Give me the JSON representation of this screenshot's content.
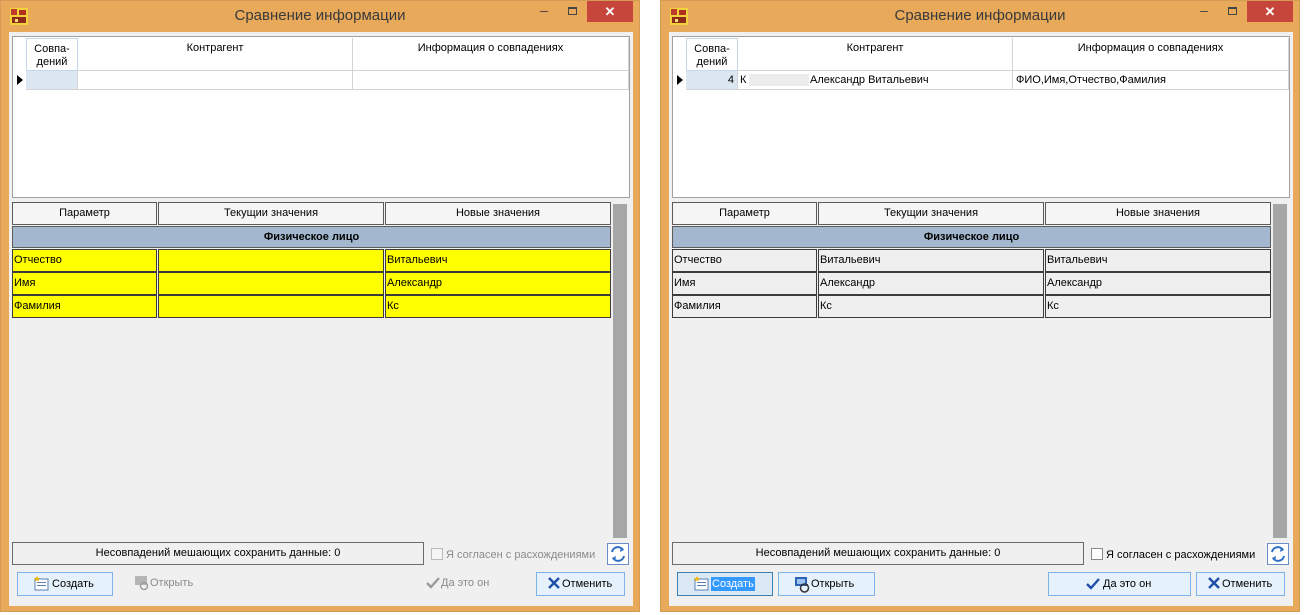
{
  "window_title": "Сравнение информации",
  "title_buttons": {
    "minimize": "–",
    "close": "✕"
  },
  "matches_grid": {
    "headers": [
      "Совпа-\nдений",
      "Контрагент",
      "Информация о совпадениях"
    ]
  },
  "compare_grid": {
    "headers": [
      "Параметр",
      "Текущии значения",
      "Новые значения"
    ],
    "group": "Физическое лицо"
  },
  "left": {
    "rows": [
      {
        "param": "Отчество",
        "current": "",
        "new": "Витальевич"
      },
      {
        "param": "Имя",
        "current": "",
        "new": "Александр"
      },
      {
        "param": "Фамилия",
        "current": "",
        "new": "Кс"
      }
    ],
    "status": "Несовпадений мешающих сохранить данные: 0",
    "agree_label": "Я согласен с расхождениями",
    "buttons": {
      "create": "Создать",
      "open": "Открыть",
      "yes": "Да это он",
      "cancel": "Отменить"
    }
  },
  "right": {
    "match": {
      "count": "4",
      "contractor_initial": "К",
      "contractor_name": "Александр Витальевич",
      "info": "ФИО,Имя,Отчество,Фамилия"
    },
    "rows": [
      {
        "param": "Отчество",
        "current": "Витальевич",
        "new": "Витальевич"
      },
      {
        "param": "Имя",
        "current": "Александр",
        "new": "Александр"
      },
      {
        "param": "Фамилия",
        "current": "Кс",
        "new": "Кс"
      }
    ],
    "status": "Несовпадений мешающих сохранить данные: 0",
    "agree_label": "Я согласен с расхождениями",
    "buttons": {
      "create": "Создать",
      "open": "Открыть",
      "yes": "Да это он",
      "cancel": "Отменить"
    }
  },
  "colors": {
    "window_frame": "#e8a95b",
    "close_button": "#c7463c",
    "mismatch_row": "#ffff00",
    "group_header": "#a3b8cf",
    "scrollbar": "#a6a6a6"
  },
  "icons": [
    "app-icon",
    "create-icon",
    "open-icon",
    "checkmark-icon",
    "cancel-x-icon",
    "refresh-icon"
  ]
}
